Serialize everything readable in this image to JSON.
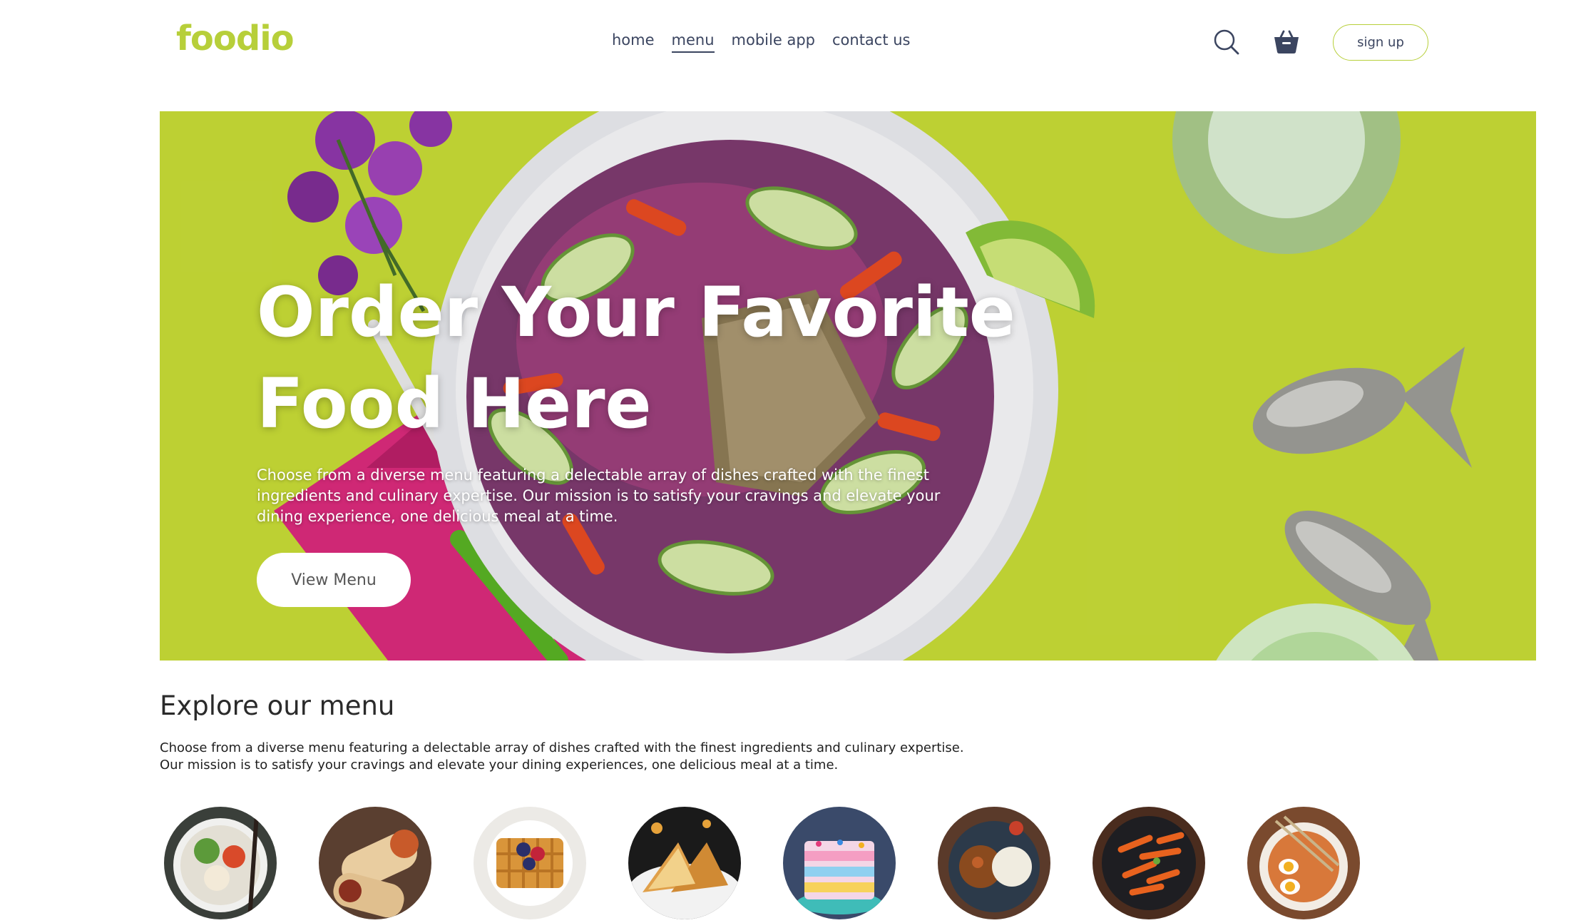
{
  "brand": {
    "name": "foodio",
    "accent_color": "#b7cf3a",
    "nav_color": "#3b4560"
  },
  "nav": {
    "items": [
      {
        "label": "home",
        "active": false
      },
      {
        "label": "menu",
        "active": true
      },
      {
        "label": "mobile app",
        "active": false
      },
      {
        "label": "contact us",
        "active": false
      }
    ]
  },
  "header_actions": {
    "search_icon": "search-icon",
    "cart_icon": "basket-icon",
    "signup_label": "sign up"
  },
  "hero": {
    "title": "Order Your Favorite Food Here",
    "description": "Choose from a diverse menu featuring a delectable array of dishes crafted with the finest ingredients and culinary expertise. Our mission is to satisfy your cravings and elevate your dining experience, one delicious meal at a time.",
    "button_label": "View Menu",
    "background_color": "#c5d936"
  },
  "explore": {
    "title": "Explore our menu",
    "description_line1": "Choose from a diverse menu featuring a delectable array of dishes crafted with the finest ingredients and culinary expertise.",
    "description_line2": "Our mission is to satisfy your cravings and elevate your dining experiences, one delicious meal at a time.",
    "dishes": [
      {
        "icon": "salad-bowl-icon",
        "color": "#8aa66a"
      },
      {
        "icon": "wrap-icon",
        "color": "#a8643a"
      },
      {
        "icon": "waffle-icon",
        "color": "#d8a24f"
      },
      {
        "icon": "sandwich-icon",
        "color": "#c98a3c"
      },
      {
        "icon": "cake-icon",
        "color": "#d46aa0"
      },
      {
        "icon": "curry-plate-icon",
        "color": "#6b4a36"
      },
      {
        "icon": "pasta-icon",
        "color": "#c0552a"
      },
      {
        "icon": "noodle-bowl-icon",
        "color": "#b37046"
      }
    ]
  }
}
